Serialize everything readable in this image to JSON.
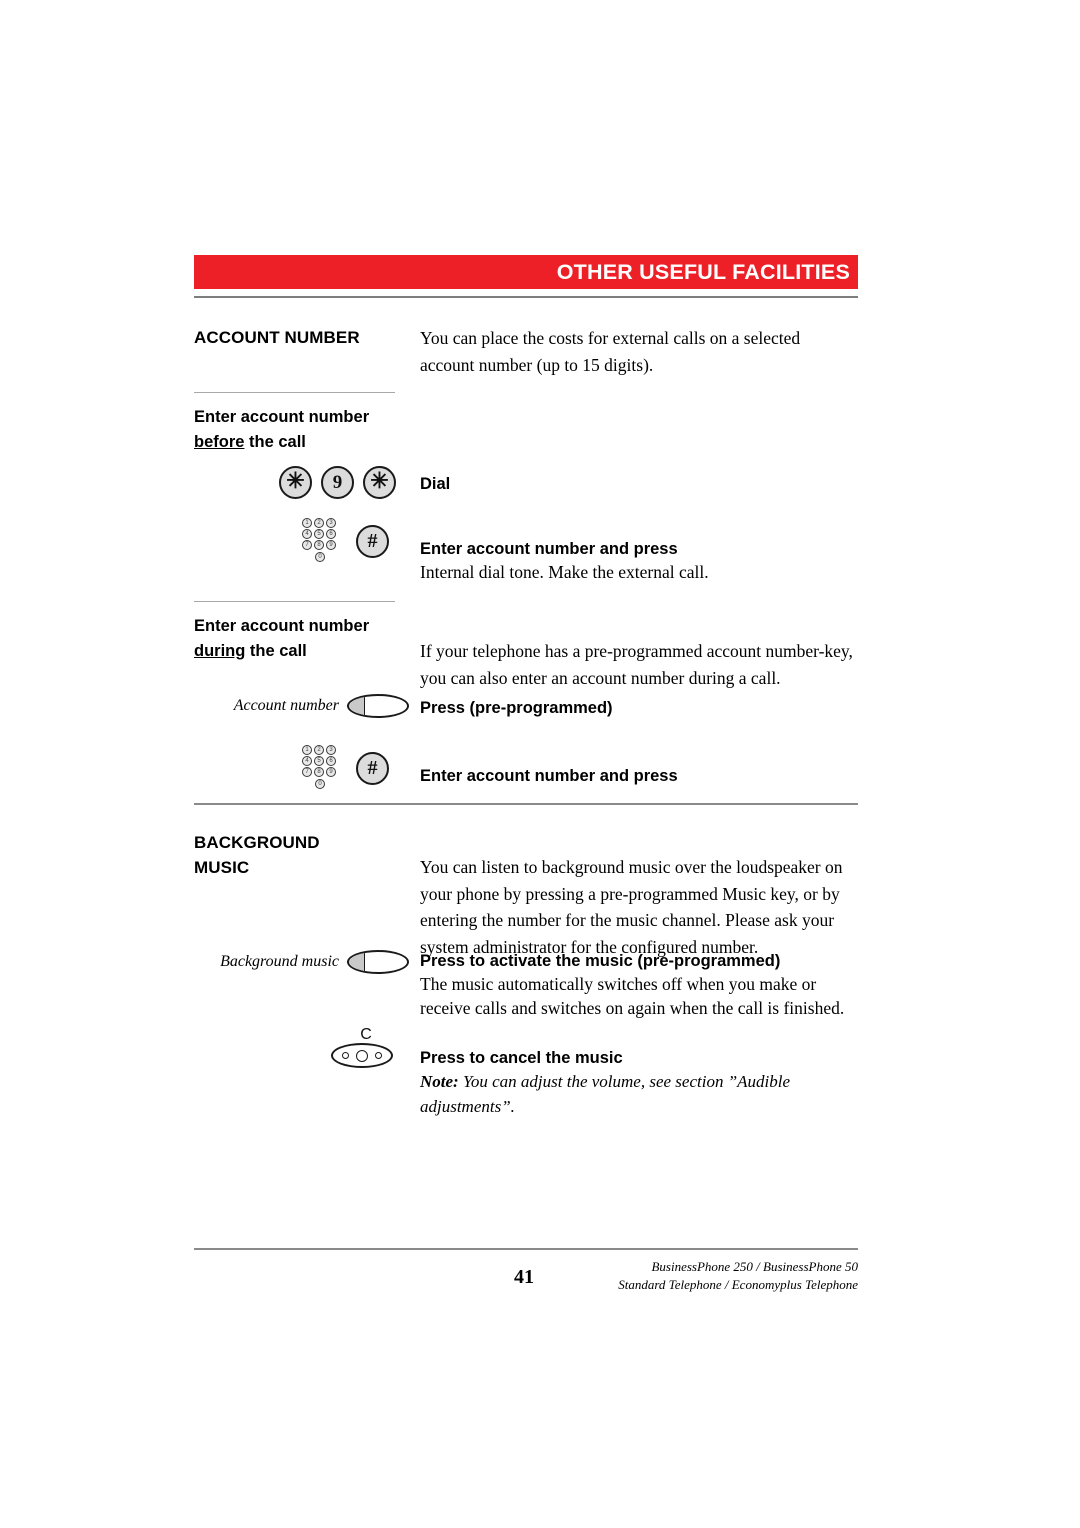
{
  "header": {
    "title": "OTHER USEFUL FACILITIES",
    "bar_color": "#ED2027",
    "title_color": "#FFFFFF"
  },
  "sections": [
    {
      "id": "account-number",
      "heading": "ACCOUNT NUMBER",
      "intro": "You can place the costs for external calls on a selected account number (up to 15 digits).",
      "subsections": [
        {
          "id": "before-call",
          "heading_line1": "Enter account number",
          "heading_underlined": "before",
          "heading_rest": " the call",
          "steps": [
            {
              "keys": [
                "star",
                "9",
                "star"
              ],
              "action": "Dial",
              "detail": ""
            },
            {
              "keys": [
                "keypad",
                "hash"
              ],
              "action": "Enter account number and press",
              "detail": "Internal dial tone. Make the external call."
            }
          ]
        },
        {
          "id": "during-call",
          "heading_line1": "Enter account number",
          "heading_underlined": "during",
          "heading_rest": " the call",
          "intro": "If your telephone has a pre-programmed account number-key, you can also enter an account number during a call.",
          "steps": [
            {
              "key_label": "Account number",
              "keys": [
                "oval"
              ],
              "action": "Press (pre-programmed)",
              "detail": ""
            },
            {
              "keys": [
                "keypad",
                "hash"
              ],
              "action": "Enter account number and press",
              "detail": ""
            }
          ]
        }
      ]
    },
    {
      "id": "background-music",
      "heading_line1": "BACKGROUND",
      "heading_line2": "MUSIC",
      "intro": "You can listen to background music over the loudspeaker on your phone by pressing a pre-programmed Music key, or by entering the number for the music channel. Please ask your system administrator for the configured number.",
      "steps": [
        {
          "key_label": "Background music",
          "keys": [
            "oval"
          ],
          "action": "Press to activate the music (pre-programmed)",
          "detail": "The music automatically switches off when you make or receive calls and switches on again when the call is finished."
        },
        {
          "keys": [
            "c-key"
          ],
          "c_letter": "C",
          "action": "Press to cancel the music",
          "note_label": "Note:",
          "note_text": " You can adjust the volume, see section ”Audible adjustments”."
        }
      ]
    }
  ],
  "keypad_digits": [
    "1",
    "2",
    "3",
    "4",
    "5",
    "6",
    "7",
    "8",
    "9",
    "0"
  ],
  "glyphs": {
    "star": "✳",
    "hash": "#",
    "nine": "9"
  },
  "footer": {
    "page_number": "41",
    "line1": "BusinessPhone 250 / BusinessPhone 50",
    "line2": "Standard Telephone / Economyplus Telephone"
  }
}
